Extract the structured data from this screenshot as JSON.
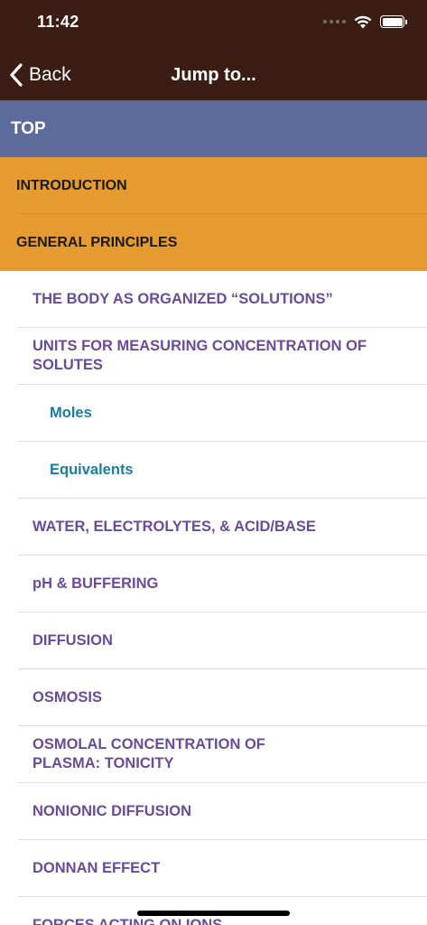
{
  "status_bar": {
    "time": "11:42"
  },
  "nav": {
    "back_label": "Back",
    "title": "Jump to..."
  },
  "sections": {
    "top": "TOP",
    "introduction": "INTRODUCTION",
    "general_principles": "GENERAL PRINCIPLES"
  },
  "items": [
    {
      "label": "THE BODY AS ORGANIZED “SOLUTIONS”",
      "level": 1
    },
    {
      "label": "UNITS FOR MEASURING CONCENTRATION OF SOLUTES",
      "level": 1
    },
    {
      "label": "Moles",
      "level": 2
    },
    {
      "label": "Equivalents",
      "level": 2
    },
    {
      "label": "WATER, ELECTROLYTES, & ACID/BASE",
      "level": 1
    },
    {
      "label": "pH & BUFFERING",
      "level": 1
    },
    {
      "label": "DIFFUSION",
      "level": 1
    },
    {
      "label": "OSMOSIS",
      "level": 1
    },
    {
      "label": "OSMOLAL CONCENTRATION OF PLASMA: TONICITY",
      "level": 1
    },
    {
      "label": "NONIONIC DIFFUSION",
      "level": 1
    },
    {
      "label": "DONNAN EFFECT",
      "level": 1
    },
    {
      "label": "FORCES ACTING ON IONS",
      "level": 1
    }
  ],
  "colors": {
    "header_bg": "#3b1d14",
    "top_row_bg": "#5c6a9c",
    "section_bg": "#e69b30",
    "level1_text": "#6a4b9a",
    "level2_text": "#1a7f9a"
  }
}
